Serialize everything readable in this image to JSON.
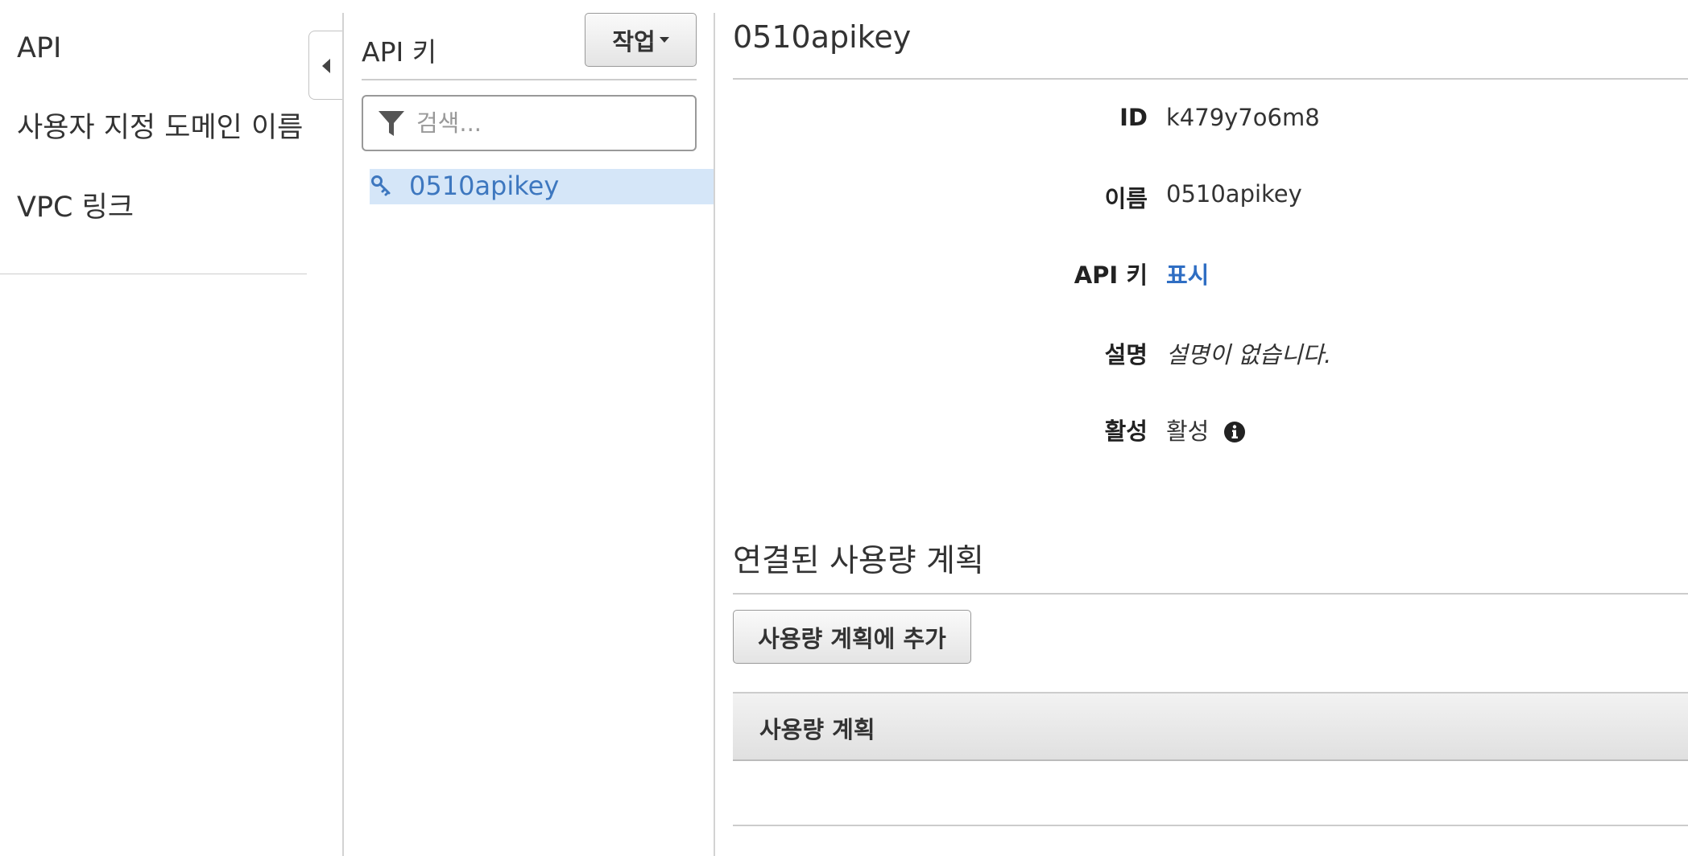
{
  "left_nav": {
    "items": [
      {
        "label": "API"
      },
      {
        "label": "사용자 지정 도메인 이름"
      },
      {
        "label": "VPC 링크"
      }
    ]
  },
  "middle_panel": {
    "title": "API 키",
    "actions_label": "작업",
    "search": {
      "placeholder": "검색...",
      "value": ""
    },
    "keys": [
      {
        "name": "0510apikey",
        "selected": true
      }
    ]
  },
  "detail": {
    "title": "0510apikey",
    "fields": {
      "id": {
        "label": "ID",
        "value": "k479y7o6m8"
      },
      "name": {
        "label": "이름",
        "value": "0510apikey"
      },
      "api_key": {
        "label": "API 키",
        "value": "표시"
      },
      "description": {
        "label": "설명",
        "value": "설명이 없습니다."
      },
      "enabled": {
        "label": "활성",
        "value": "활성"
      }
    },
    "usage_plans": {
      "section_title": "연결된 사용량 계획",
      "add_button": "사용량 계획에 추가",
      "table_header": "사용량 계획",
      "rows": []
    }
  },
  "icons": {
    "collapse": "chevron-left-icon",
    "filter": "filter-icon",
    "key": "key-icon",
    "info": "info-icon",
    "dropdown": "caret-down-icon"
  },
  "colors": {
    "link": "#2f6ec3",
    "selected_row_bg": "#d5e6f8",
    "selected_row_text": "#3d77bf"
  }
}
